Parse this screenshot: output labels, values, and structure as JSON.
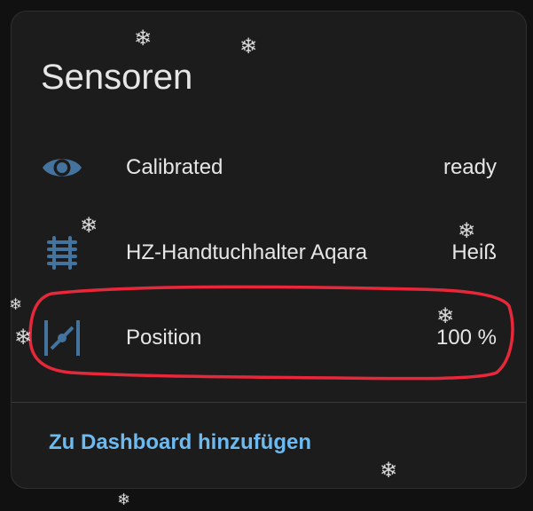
{
  "card": {
    "title": "Sensoren",
    "rows": [
      {
        "icon": "eye-icon",
        "name": "Calibrated",
        "state": "ready"
      },
      {
        "icon": "radiator-icon",
        "name": "HZ-Handtuchhalter Aqara",
        "state": "Heiß"
      },
      {
        "icon": "valve-position-icon",
        "name": "Position",
        "state": "100 %"
      }
    ],
    "action_label": "Zu Dashboard hinzufügen"
  },
  "colors": {
    "background": "#1c1c1c",
    "text": "#e6e6e6",
    "icon": "#44739e",
    "action": "#6cbaf0",
    "highlight": "#e8283a"
  },
  "decorations": {
    "flake_glyph": "❄"
  }
}
